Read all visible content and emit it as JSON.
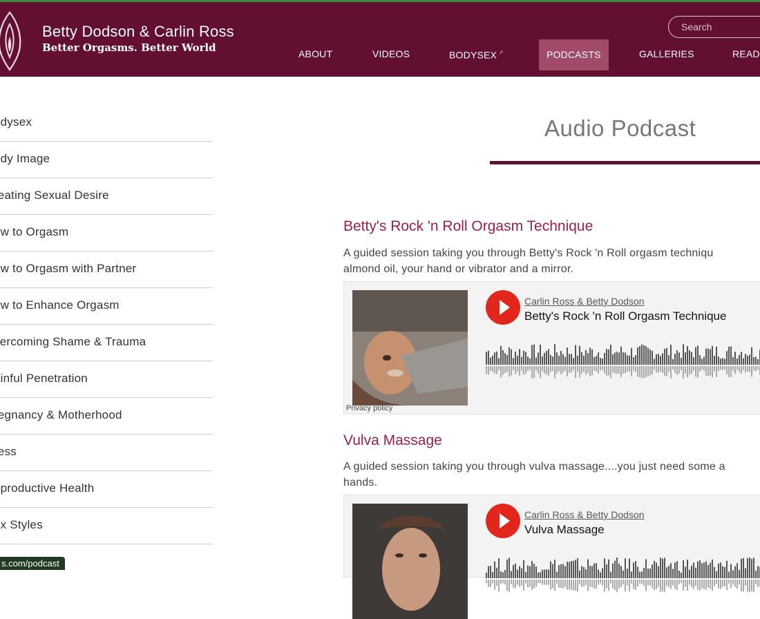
{
  "header": {
    "site_title": "Betty Dodson & Carlin Ross",
    "tagline": "Better Orgasms. Better World",
    "search_placeholder": "Search",
    "nav": [
      "ABOUT",
      "VIDEOS",
      "BODYSEX",
      "PODCASTS",
      "GALLERIES",
      "READ"
    ],
    "active_nav": "PODCASTS"
  },
  "sidebar": {
    "items": [
      "odysex",
      "ody Image",
      "reating Sexual Desire",
      "ow to Orgasm",
      "ow to Orgasm with Partner",
      "ow to Enhance Orgasm",
      "vercoming Shame & Trauma",
      "ainful Penetration",
      "regnancy & Motherhood",
      "ress",
      "eproductive Health",
      "ex Styles"
    ]
  },
  "main": {
    "page_title": "Audio Podcast",
    "episodes": [
      {
        "title": "Betty's Rock 'n Roll Orgasm Technique",
        "description_line1": "A guided session taking you through Betty's Rock 'n Roll orgasm techniqu",
        "description_line2": "almond oil, your hand or vibrator and a mirror.",
        "author": "Carlin Ross & Betty Dodson",
        "track": "Betty's Rock 'n Roll Orgasm Technique",
        "privacy": "Privacy policy"
      },
      {
        "title": "Vulva Massage",
        "description_line1": "A guided session taking you through vulva massage....you just need some a",
        "description_line2": "hands.",
        "author": "Carlin Ross & Betty Dodson",
        "track": "Vulva Massage"
      }
    ]
  },
  "status_bar": {
    "url": "s.com/podcast"
  },
  "colors": {
    "header": "#620f32",
    "active_nav": "#a24a69",
    "episode_title": "#9a1f4f",
    "play": "#e3261b"
  }
}
